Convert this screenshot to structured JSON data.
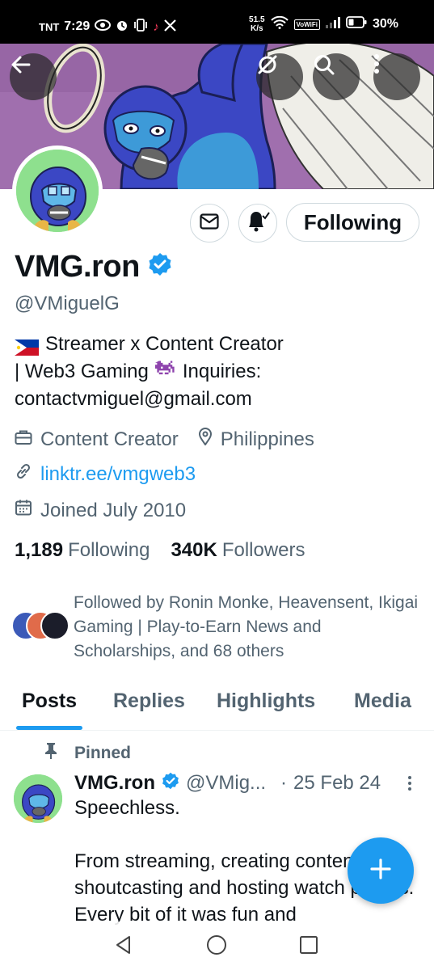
{
  "status_bar": {
    "carrier": "TNT",
    "time": "7:29",
    "net_speed_value": "51.5",
    "net_speed_unit": "K/s",
    "vowifi": "VoWiFi",
    "battery": "30%"
  },
  "banner": {
    "back_icon": "arrow-left-icon",
    "grok_icon": "grok-icon",
    "search_icon": "search-icon",
    "more_icon": "more-vertical-icon"
  },
  "profile": {
    "display_name": "VMG.ron",
    "handle": "@VMiguelG",
    "verified_color": "#1d9bf0",
    "following_button": "Following",
    "bio": {
      "line1": "Streamer x Content Creator",
      "line2a": "| Web3 Gaming",
      "line2b": "Inquiries:",
      "line3": "contactvmiguel@gmail.com"
    },
    "category": "Content Creator",
    "location": "Philippines",
    "link": "linktr.ee/vmgweb3",
    "joined": "Joined July 2010",
    "following_count": "1,189",
    "following_label": "Following",
    "followers_count": "340K",
    "followers_label": "Followers",
    "followed_by": "Followed by Ronin Monke, Heavensent, Ikigai Gaming | Play-to-Earn News and Scholarships, and 68 others"
  },
  "tabs": [
    "Posts",
    "Replies",
    "Highlights",
    "Media"
  ],
  "tweet": {
    "pinned_label": "Pinned",
    "name": "VMG.ron",
    "handle": "@VMig...",
    "separator": "·",
    "date": "25 Feb 24",
    "text_p1": "Speechless.",
    "text_p2": "From streaming, creating content, shoutcasting and hosting watch parties. Every bit of it was fun and"
  },
  "colors": {
    "accent": "#1d9bf0",
    "secondary_text": "#536471",
    "primary_text": "#0f1419"
  }
}
